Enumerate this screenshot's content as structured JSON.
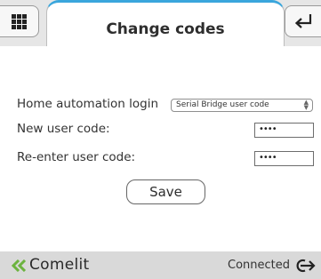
{
  "header": {
    "title": "Change codes",
    "menu_icon": "grid-icon",
    "back_icon": "return-arrow-icon",
    "accent_color": "#3aa6dc"
  },
  "form": {
    "home_automation_label": "Home automation login",
    "home_automation_selected": "Serial Bridge user code",
    "new_code_label": "New user code:",
    "new_code_value": "••••",
    "reenter_code_label": "Re-enter user code:",
    "reenter_code_value": "••••",
    "save_label": "Save"
  },
  "footer": {
    "brand": "Comelit",
    "status": "Connected",
    "status_icon": "logout-arrow-icon"
  }
}
